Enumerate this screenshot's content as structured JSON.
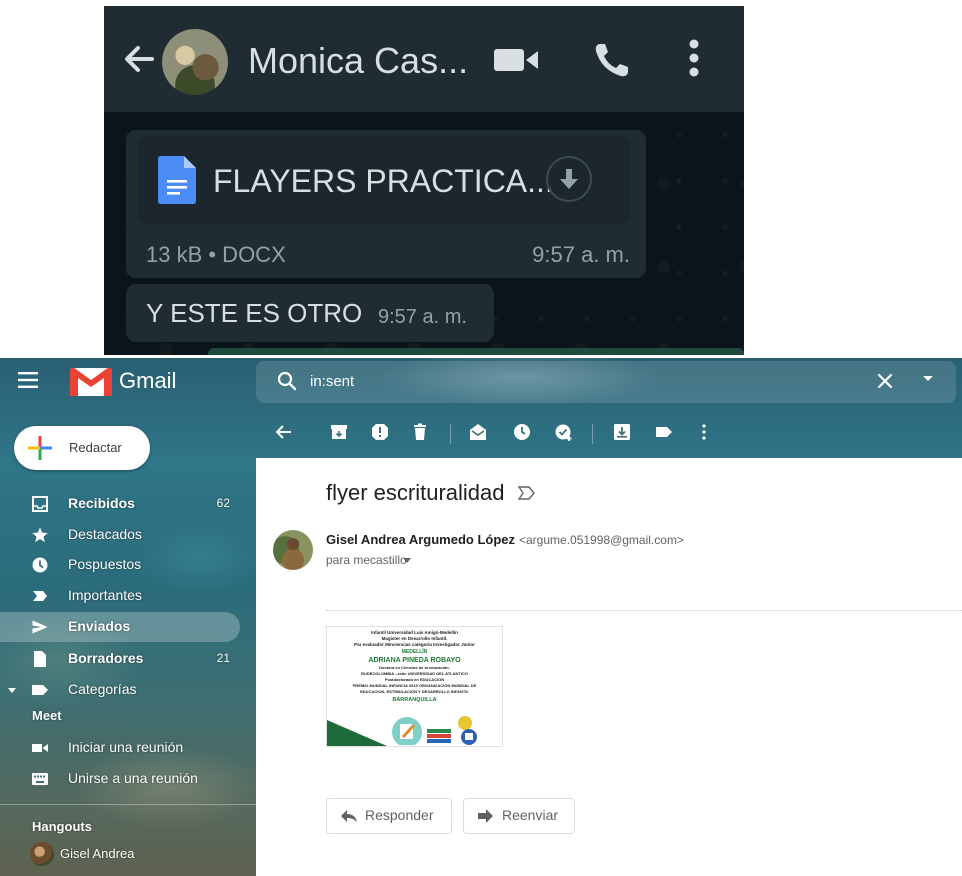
{
  "whatsapp": {
    "contact_name": "Monica Cas...",
    "document": {
      "file_name": "FLAYERS PRACTICA...",
      "meta": "13 kB • DOCX",
      "time": "9:57 a. m."
    },
    "text_message": {
      "text": "Y ESTE ES OTRO",
      "time": "9:57 a. m."
    },
    "colors": {
      "header": "#1f2c34",
      "bubble": "#202c33",
      "doc_icon": "#4b8cf5"
    }
  },
  "gmail": {
    "app_name": "Gmail",
    "search": {
      "value": "in:sent"
    },
    "compose_label": "Redactar",
    "nav": [
      {
        "label": "Recibidos",
        "count": "62",
        "icon": "inbox-icon"
      },
      {
        "label": "Destacados",
        "count": "",
        "icon": "star-icon"
      },
      {
        "label": "Pospuestos",
        "count": "",
        "icon": "clock-icon"
      },
      {
        "label": "Importantes",
        "count": "",
        "icon": "important-icon"
      },
      {
        "label": "Enviados",
        "count": "",
        "icon": "send-icon"
      },
      {
        "label": "Borradores",
        "count": "21",
        "icon": "draft-icon"
      },
      {
        "label": "Categorías",
        "count": "",
        "icon": "label-icon"
      }
    ],
    "meet": {
      "heading": "Meet",
      "start_meeting": "Iniciar una reunión",
      "join_meeting": "Unirse a una reunión"
    },
    "hangouts": {
      "heading": "Hangouts",
      "user": "Gisel Andrea"
    },
    "message": {
      "subject": "flyer escrituralidad",
      "sender_name": "Gisel Andrea Argumedo López",
      "sender_email": "<argume.051998@gmail.com>",
      "recipient": "para mecastillo",
      "attachment_lines": [
        "Infantil Universidad Luis Amigó-Medellín",
        "Magister en Desarrollo Infantil.",
        "Par evaluador Minciencias categoría Investigador Junior",
        "MEDELLÍN",
        "ADRIANA PINEDA ROBAYO",
        "Doctora en Ciencias de la educación.",
        "RUDECOLOMBIA –sede UNIVERSIDAD DEL ATLANTICO",
        "Postdoctorado en EDUCACION",
        "PREMIO MUNDIAL INFANCIA 2019 ORGANIZACIÓN MUNDIAL DE",
        "EDUCACION, ESTIMULACION Y DESARROLLO INFANTIL",
        "BARRANQUILLA"
      ],
      "reply_label": "Responder",
      "forward_label": "Reenviar"
    },
    "colors": {
      "gmail_red": "#ea4335",
      "text_dark": "#202124",
      "text_gray": "#5f6368"
    }
  }
}
